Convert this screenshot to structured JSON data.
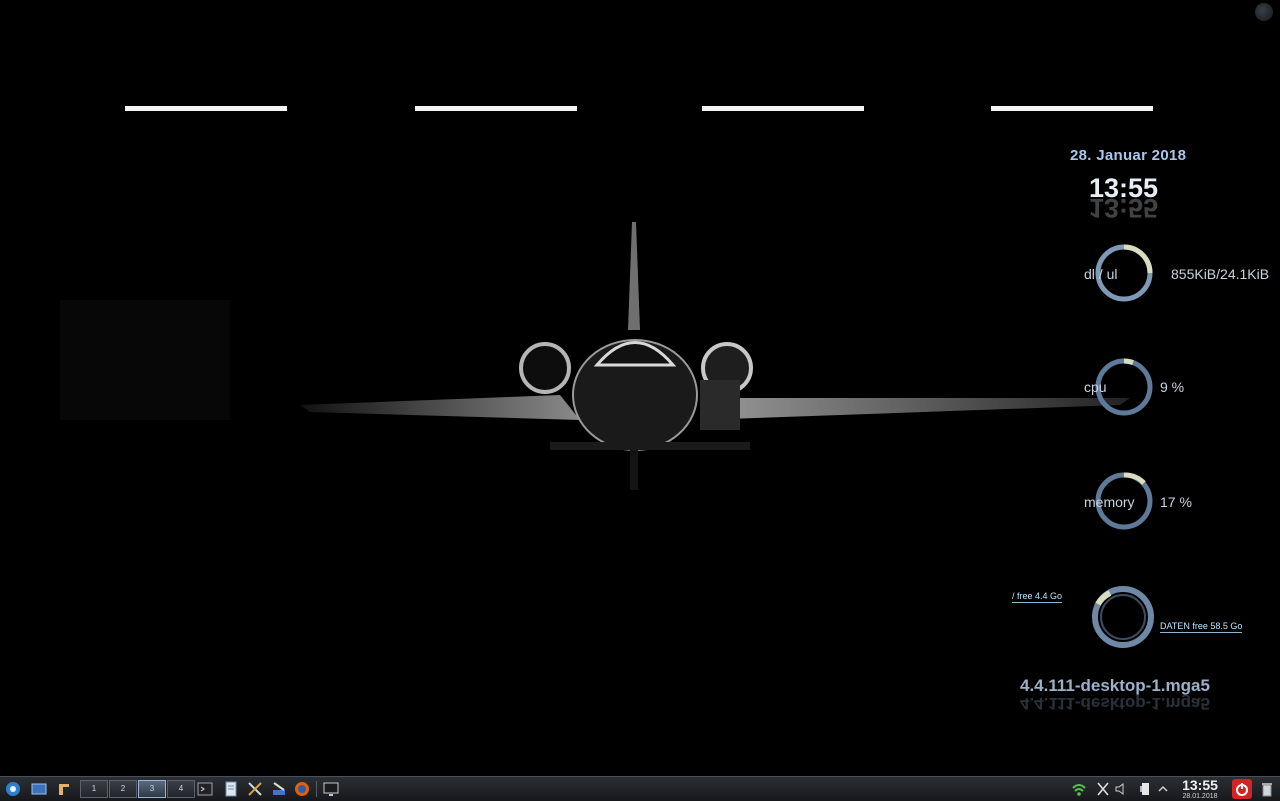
{
  "desktop": {
    "date": "28. Januar 2018",
    "time": "13:55",
    "kernel": "4.4.111-desktop-1.mga5"
  },
  "widgets": {
    "network": {
      "label": "dl / ul",
      "value": "855KiB/24.1KiB"
    },
    "cpu": {
      "label": "cpu",
      "value": "9 %",
      "level": 0.09
    },
    "memory": {
      "label": "memory",
      "value": "17 %",
      "level": 0.17
    },
    "disk": {
      "root_label": "/ free 4.4 Go",
      "data_label": "DATEN free 58.5 Go"
    }
  },
  "taskbar": {
    "pager": [
      "1",
      "2",
      "3",
      "4"
    ],
    "active_desktop": "3",
    "clock_time": "13:55",
    "clock_date": "28.01.2018"
  },
  "colors": {
    "ring_track": "#7f98b5",
    "ring_accent": "#d9ddc0",
    "taskbar_bg": "#1c1f24",
    "power_red": "#d32424"
  }
}
